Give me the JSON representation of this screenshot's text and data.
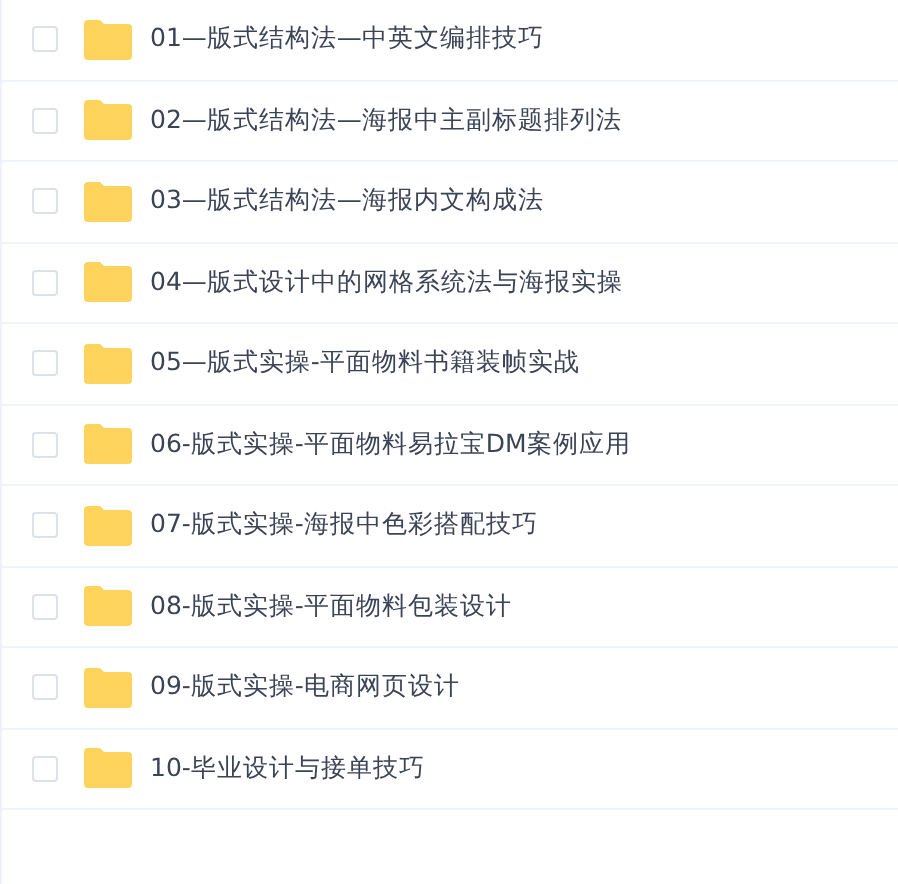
{
  "files": [
    {
      "name": "01—版式结构法—中英文编排技巧",
      "checked": false
    },
    {
      "name": "02—版式结构法—海报中主副标题排列法",
      "checked": false
    },
    {
      "name": "03—版式结构法—海报内文构成法",
      "checked": false
    },
    {
      "name": "04—版式设计中的网格系统法与海报实操",
      "checked": false
    },
    {
      "name": "05—版式实操-平面物料书籍装帧实战",
      "checked": false
    },
    {
      "name": "06-版式实操-平面物料易拉宝DM案例应用",
      "checked": false
    },
    {
      "name": "07-版式实操-海报中色彩搭配技巧",
      "checked": false
    },
    {
      "name": "08-版式实操-平面物料包装设计",
      "checked": false
    },
    {
      "name": "09-版式实操-电商网页设计",
      "checked": false
    },
    {
      "name": "10-毕业设计与接单技巧",
      "checked": false
    }
  ]
}
